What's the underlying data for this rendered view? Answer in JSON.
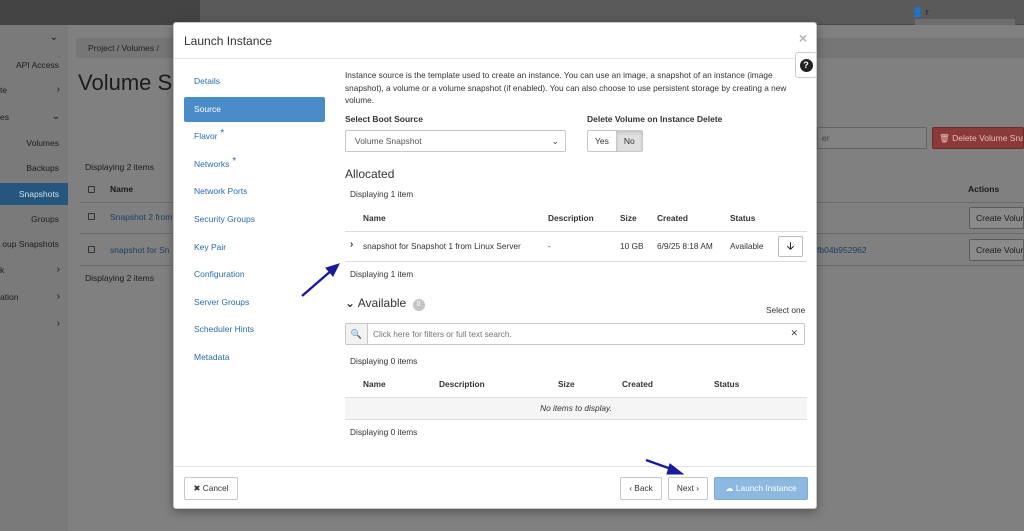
{
  "background": {
    "breadcrumb": "Project  /  Volumes  /",
    "page_title": "Volume S",
    "sidebar": [
      {
        "label": "API Access",
        "top": 0
      },
      {
        "label": "te"
      },
      {
        "label": "es"
      },
      {
        "label": "Volumes"
      },
      {
        "label": "Backups"
      },
      {
        "label": "Snapshots"
      },
      {
        "label": "Groups"
      },
      {
        "label": "oup Snapshots"
      },
      {
        "label": "k"
      },
      {
        "label": "ation"
      }
    ],
    "displaying_top": "Displaying 2 items",
    "displaying_bottom": "Displaying 2 items",
    "col_name": "Name",
    "col_actions": "Actions",
    "row1_name": "Snapshot 2 from",
    "row2_name": "snapshot for Sn",
    "row2_id": "fb04b952962",
    "filter_placeholder": "er",
    "delete_button": "🗑 Delete Volume Sna",
    "create_button_1": "Create Volum",
    "create_button_2": "Create Volum",
    "user_label": "👤 r"
  },
  "modal": {
    "title": "Launch Instance",
    "close": "×",
    "help": "?",
    "nav": [
      {
        "label": "Details",
        "required": false
      },
      {
        "label": "Source",
        "required": false,
        "active": true
      },
      {
        "label": "Flavor",
        "required": true
      },
      {
        "label": "Networks",
        "required": true
      },
      {
        "label": "Network Ports",
        "required": false
      },
      {
        "label": "Security Groups",
        "required": false
      },
      {
        "label": "Key Pair",
        "required": false
      },
      {
        "label": "Configuration",
        "required": false
      },
      {
        "label": "Server Groups",
        "required": false
      },
      {
        "label": "Scheduler Hints",
        "required": false
      },
      {
        "label": "Metadata",
        "required": false
      }
    ],
    "intro_text": "Instance source is the template used to create an instance. You can use an image, a snapshot of an instance (image snapshot), a volume or a volume snapshot (if enabled). You can also choose to use persistent storage by creating a new volume.",
    "boot_source_label": "Select Boot Source",
    "boot_source_value": "Volume Snapshot",
    "delete_volume_label": "Delete Volume on Instance Delete",
    "toggle_yes": "Yes",
    "toggle_no": "No",
    "allocated": {
      "heading": "Allocated",
      "displaying_top": "Displaying 1 item",
      "columns": {
        "name": "Name",
        "description": "Description",
        "size": "Size",
        "created": "Created",
        "status": "Status"
      },
      "row": {
        "name": "snapshot for Snapshot 1 from Linux Server",
        "description": "-",
        "size": "10 GB",
        "created": "6/9/25 8:18 AM",
        "status": "Available"
      },
      "displaying_bottom": "Displaying 1 item"
    },
    "available": {
      "heading": "Available",
      "count": "0",
      "select_one": "Select one",
      "search_placeholder": "Click here for filters or full text search.",
      "displaying_top": "Displaying 0 items",
      "columns": {
        "name": "Name",
        "description": "Description",
        "size": "Size",
        "created": "Created",
        "status": "Status"
      },
      "empty": "No items to display.",
      "displaying_bottom": "Displaying 0 items"
    },
    "footer": {
      "cancel": "✖ Cancel",
      "back": "‹ Back",
      "next": "Next ›",
      "launch": "☁ Launch Instance"
    }
  },
  "colors": {
    "accent": "#4a8cc8",
    "link": "#2a6ca8",
    "primary_disabled": "#8db9e0",
    "annotation_arrow": "#1a1a9c",
    "danger": "#8a3a39"
  }
}
